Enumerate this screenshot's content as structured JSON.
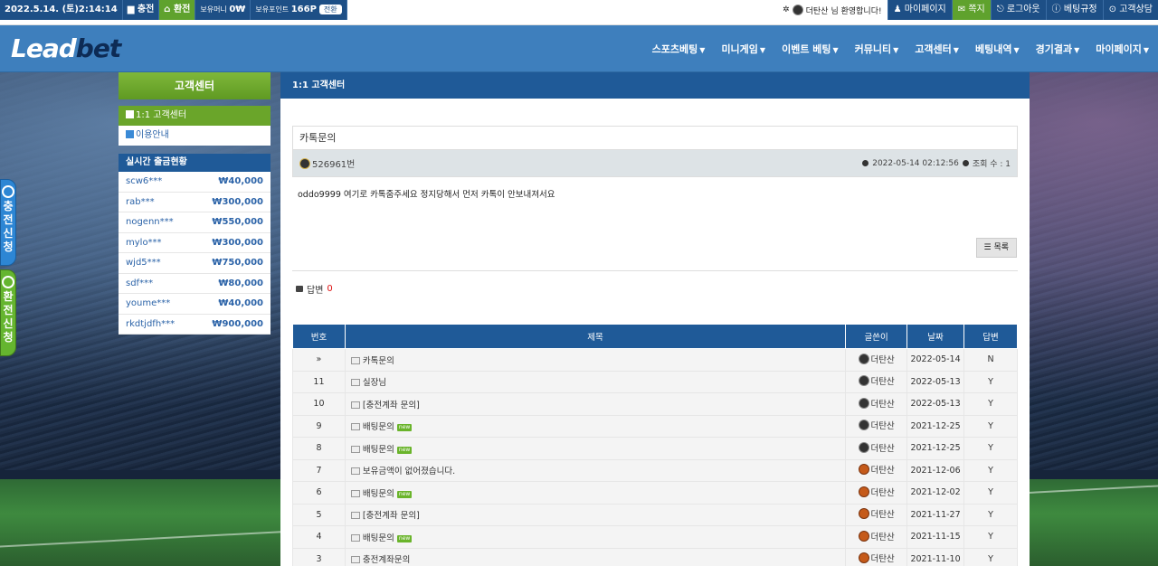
{
  "topbar": {
    "datetime": "2022.5.14. (토)2:14:14",
    "charge": "충전",
    "exchange": "환전",
    "money_label": "보유머니",
    "money_value": "0₩",
    "point_label": "보유포인트",
    "point_value": "166P",
    "point_button": "전환",
    "welcome_name": "더탄산",
    "welcome_text": "님 환영합니다!",
    "buttons": [
      "마이페이지",
      "쪽지",
      "로그아웃",
      "베팅규정",
      "고객상담"
    ]
  },
  "header": {
    "logo_a": "Lead",
    "logo_b": "bet",
    "nav": [
      "스포츠베팅",
      "미니게임",
      "이벤트 베팅",
      "커뮤니티",
      "고객센터",
      "베팅내역",
      "경기결과",
      "마이페이지"
    ]
  },
  "float": {
    "charge": "충전신청",
    "exchange": "환전신청"
  },
  "sidebar": {
    "title": "고객센터",
    "menu1": "1:1 고객센터",
    "menu2": "이용안내",
    "realtime_title": "실시간 출금현황",
    "realtime": [
      {
        "user": "scw6***",
        "amount": "₩40,000"
      },
      {
        "user": "rab***",
        "amount": "₩300,000"
      },
      {
        "user": "nogenn***",
        "amount": "₩550,000"
      },
      {
        "user": "mylo***",
        "amount": "₩300,000"
      },
      {
        "user": "wjd5***",
        "amount": "₩750,000"
      },
      {
        "user": "sdf***",
        "amount": "₩80,000"
      },
      {
        "user": "youme***",
        "amount": "₩40,000"
      },
      {
        "user": "rkdtjdfh***",
        "amount": "₩900,000"
      }
    ]
  },
  "main": {
    "section_title": "1:1 고객센터",
    "post": {
      "title": "카톡문의",
      "id": "526961번",
      "date": "2022-05-14 02:12:56",
      "views": "조회 수 : 1",
      "body": "oddo9999 여기로 카톡줌주세요 정지당해서 먼저 카톡이 안보내져서요"
    },
    "list_button": "목록",
    "reply_label": "답변",
    "reply_count": "0",
    "table": {
      "headers": [
        "번호",
        "제목",
        "글쓴이",
        "날짜",
        "답변"
      ],
      "rows": [
        {
          "no": "»",
          "title": "카톡문의",
          "new": false,
          "writer": "더탄산",
          "lv": "dark",
          "date": "2022-05-14",
          "answer": "N"
        },
        {
          "no": "11",
          "title": "실장님",
          "new": false,
          "writer": "더탄산",
          "lv": "dark",
          "date": "2022-05-13",
          "answer": "Y"
        },
        {
          "no": "10",
          "title": "[충전계좌 문의]",
          "new": false,
          "writer": "더탄산",
          "lv": "dark",
          "date": "2022-05-13",
          "answer": "Y"
        },
        {
          "no": "9",
          "title": "배팅문의",
          "new": true,
          "writer": "더탄산",
          "lv": "dark",
          "date": "2021-12-25",
          "answer": "Y"
        },
        {
          "no": "8",
          "title": "배팅문의",
          "new": true,
          "writer": "더탄산",
          "lv": "dark",
          "date": "2021-12-25",
          "answer": "Y"
        },
        {
          "no": "7",
          "title": "보유금액이 없어졌습니다.",
          "new": false,
          "writer": "더탄산",
          "lv": "orange",
          "date": "2021-12-06",
          "answer": "Y"
        },
        {
          "no": "6",
          "title": "배팅문의",
          "new": true,
          "writer": "더탄산",
          "lv": "orange",
          "date": "2021-12-02",
          "answer": "Y"
        },
        {
          "no": "5",
          "title": "[충전계좌 문의]",
          "new": false,
          "writer": "더탄산",
          "lv": "orange",
          "date": "2021-11-27",
          "answer": "Y"
        },
        {
          "no": "4",
          "title": "배팅문의",
          "new": true,
          "writer": "더탄산",
          "lv": "orange",
          "date": "2021-11-15",
          "answer": "Y"
        },
        {
          "no": "3",
          "title": "충전계좌문의",
          "new": false,
          "writer": "더탄산",
          "lv": "orange",
          "date": "2021-11-10",
          "answer": "Y"
        }
      ],
      "new_badge": "new"
    }
  }
}
